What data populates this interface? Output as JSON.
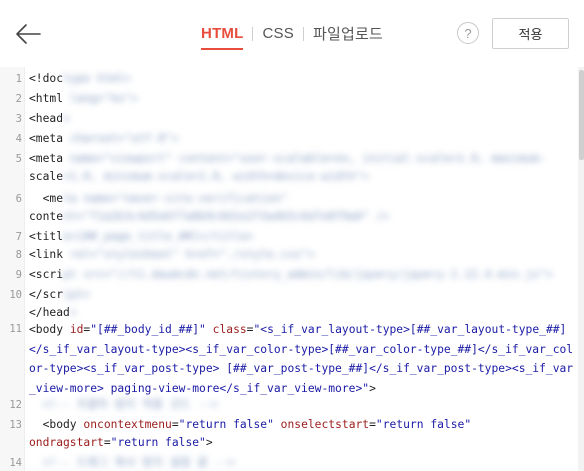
{
  "header": {
    "tabs": [
      {
        "label": "HTML",
        "active": true
      },
      {
        "label": "CSS",
        "active": false
      },
      {
        "label": "파일업로드",
        "active": false
      }
    ],
    "help_label": "?",
    "apply_label": "적용"
  },
  "editor": {
    "line_numbers": [
      "1",
      "2",
      "3",
      "4",
      "5",
      "6",
      "7",
      "8",
      "9",
      "10",
      "11",
      "12",
      "13",
      "14"
    ],
    "lines": {
      "l1_visible": "<!doc",
      "l1_blur": "type html>",
      "l2_visible": "<html",
      "l2_blur": " lang=\"ko\">",
      "l3_visible": "<head",
      "l3_blur": ">",
      "l4_visible": "<meta",
      "l4_blur": " charset=\"utf-8\">",
      "l5_visible": "<meta",
      "l5_blur": " name=\"viewport\" content=\"user-scalable=no, initial-scale=1.0, maximum-",
      "l5b_visible": "scale",
      "l5b_blur": "=1.0, minimum-scale=1.0, width=device-width\">",
      "l6_visible": "  <me",
      "l6_blur": "ta name=\"naver-site-verification\"",
      "l6b_visible": "conte",
      "l6b_blur": "nt=\"f1a2b3c4d5e6f7a8b9c0d1e2f3a4b5c6d7e8f9a0\" />",
      "l7_visible": "<titl",
      "l7_blur": "e>[##_page_title_##]</title>",
      "l8_visible": "<link",
      "l8_blur": " rel=\"stylesheet\" href=\"./style.css\">",
      "l9_visible": "<scri",
      "l9_blur": "pt src=\"//t1.daumcdn.net/tistory_admin/lib/jquery/jquery-1.12.4.min.js\">",
      "l10_visible": "</scr",
      "l10_blur": "ipt>",
      "l10b_visible": "</head",
      "l10b_blur": ">",
      "l11": {
        "tag_open": "<body ",
        "id_attr": "id",
        "id_val": "\"[##_body_id_##]\"",
        "class_attr": " class",
        "class_val": "\"<s_if_var_layout-type>[##_var_layout-type_##]</s_if_var_layout-type><s_if_var_color-type>[##_var_color-type_##]</s_if_var_color-type><s_if_var_post-type> [##_var_post-type_##]</s_if_var_post-type><s_if_var_view-more> paging-view-more</s_if_var_view-more>\"",
        "tag_close": ">"
      },
      "l12_blur": "  <!-- 우클릭 방지 적용 코드 -->",
      "l13": {
        "prefix": "  <body ",
        "a1": "oncontextmenu",
        "v1": "\"return false\"",
        "a2": " onselectstart",
        "v2": "\"return false\"",
        "a3": "ondragstart",
        "v3": "\"return false\"",
        "close": ">"
      },
      "l14_blur": "  <!-- 드래그 복사 방지 설정 끝 -->"
    }
  },
  "colors": {
    "accent": "#e84c3d",
    "attr": "#9b1c1c",
    "string": "#1a1aa6"
  },
  "icons": {
    "back": "back-arrow-icon",
    "help": "question-mark-icon"
  }
}
